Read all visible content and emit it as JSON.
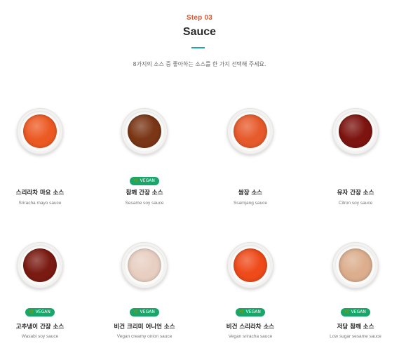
{
  "header": {
    "step": "Step 03",
    "title": "Sauce",
    "subtitle": "8가지의 소스 중 좋아하는 소스를 한 가지 선택해 주세요."
  },
  "colors": {
    "accent": "#e8522a",
    "vegan_badge": "#1aa56b",
    "divider": "#1ea7a4"
  },
  "items": [
    {
      "name": "스리라차 마요 소스",
      "en": "Sriracha mayo sauce",
      "vegan": false,
      "badge": "",
      "sauce_color": "#ec5a23"
    },
    {
      "name": "참깨 간장 소스",
      "en": "Sesame soy sauce",
      "vegan": true,
      "badge": "VEGAN",
      "sauce_color": "#7a3616"
    },
    {
      "name": "쌈장 소스",
      "en": "Ssamjang sauce",
      "vegan": false,
      "badge": "",
      "sauce_color": "#e65a2b"
    },
    {
      "name": "유자 간장 소스",
      "en": "Citron soy sauce",
      "vegan": false,
      "badge": "",
      "sauce_color": "#7d1410"
    },
    {
      "name": "고추냉이 간장 소스",
      "en": "Wasabi soy sauce",
      "vegan": true,
      "badge": "VEGAN",
      "sauce_color": "#7a1b12"
    },
    {
      "name": "비건 크리미 어니언 소스",
      "en": "Vegan creamy onion sauce",
      "vegan": true,
      "badge": "VEGAN",
      "sauce_color": "#e8cfc2"
    },
    {
      "name": "비건 스리라차 소스",
      "en": "Vegan sriracha sauce",
      "vegan": true,
      "badge": "VEGAN",
      "sauce_color": "#ee4a1a"
    },
    {
      "name": "저당 참깨 소스",
      "en": "Low sugar sesame sauce",
      "vegan": true,
      "badge": "VEGAN",
      "sauce_color": "#dcae8e"
    }
  ]
}
